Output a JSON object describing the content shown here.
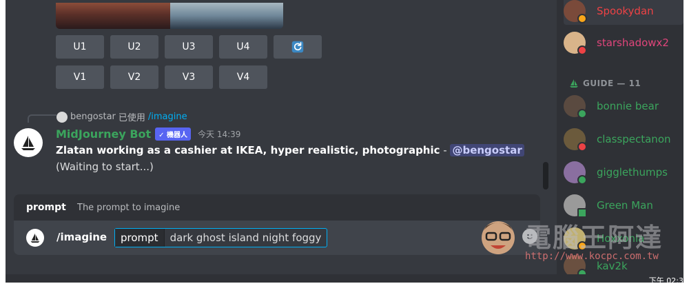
{
  "chat": {
    "buttons_row1": [
      "U1",
      "U2",
      "U3",
      "U4"
    ],
    "buttons_row2": [
      "V1",
      "V2",
      "V3",
      "V4"
    ],
    "refresh_icon": "refresh-icon",
    "reply": {
      "user": "bengostar",
      "used_text": "已使用",
      "command": "/imagine"
    },
    "message": {
      "author": "MidJourney Bot",
      "bot_tag": "✓ 機器人",
      "timestamp": "今天 14:39",
      "prompt_text": "Zlatan working as a cashier at IKEA, hyper realistic, photographic",
      "separator": " - ",
      "mention": "@bengostar",
      "status": "(Waiting to start...)"
    }
  },
  "composer": {
    "option_label": "prompt",
    "option_desc": "The prompt to imagine",
    "command": "/imagine",
    "option_key": "prompt",
    "option_value": "dark ghost island night foggy",
    "emoji_icon": "emoji-icon"
  },
  "members": {
    "top": [
      {
        "name": "Spookydan",
        "color": "#ed4245",
        "status": "idle"
      },
      {
        "name": "starshadowx2",
        "color": "#e0457b",
        "status": "dnd"
      }
    ],
    "group_label": "GUIDE — 11",
    "guide": [
      {
        "name": "bonnie bear",
        "color": "#3ba55d",
        "status": "online"
      },
      {
        "name": "classpectanon",
        "color": "#3ba55d",
        "status": "dnd"
      },
      {
        "name": "gigglethumps",
        "color": "#3ba55d",
        "status": "online"
      },
      {
        "name": "Green Man",
        "color": "#3ba55d",
        "status": "mobile"
      },
      {
        "name": "Hoxxonia",
        "color": "#3ba55d",
        "status": "idle"
      },
      {
        "name": "kav2k",
        "color": "#3ba55d",
        "status": "online"
      }
    ]
  },
  "statusbar": {
    "clock": "下午 02:3"
  },
  "watermark": {
    "title": "電腦王阿達",
    "url": "http://www.kocpc.com.tw"
  }
}
